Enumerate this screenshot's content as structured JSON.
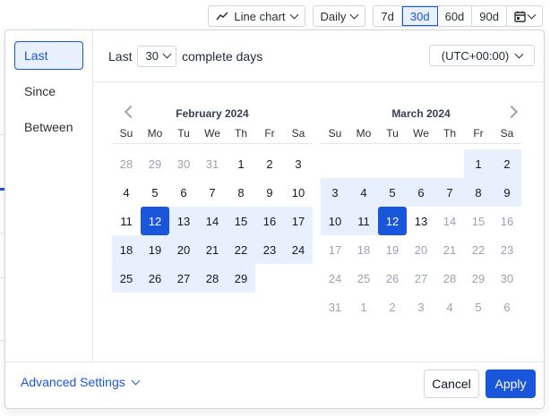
{
  "toolbar": {
    "chart_type": "Line chart",
    "interval": "Daily",
    "ranges": [
      "7d",
      "30d",
      "60d",
      "90d"
    ],
    "active_range": "30d"
  },
  "sidebar": {
    "items": [
      {
        "label": "Last",
        "active": true
      },
      {
        "label": "Since",
        "active": false
      },
      {
        "label": "Between",
        "active": false
      }
    ]
  },
  "header": {
    "prefix": "Last",
    "count": "30",
    "suffix": "complete days",
    "timezone": "(UTC+00:00)"
  },
  "weekdays": [
    "Su",
    "Mo",
    "Tu",
    "We",
    "Th",
    "Fr",
    "Sa"
  ],
  "calendars": [
    {
      "title": "February 2024",
      "id": "feb",
      "days": [
        {
          "d": "28",
          "s": "muted"
        },
        {
          "d": "29",
          "s": "muted"
        },
        {
          "d": "30",
          "s": "muted"
        },
        {
          "d": "31",
          "s": "muted"
        },
        {
          "d": "1",
          "s": ""
        },
        {
          "d": "2",
          "s": ""
        },
        {
          "d": "3",
          "s": ""
        },
        {
          "d": "4",
          "s": ""
        },
        {
          "d": "5",
          "s": ""
        },
        {
          "d": "6",
          "s": ""
        },
        {
          "d": "7",
          "s": ""
        },
        {
          "d": "8",
          "s": ""
        },
        {
          "d": "9",
          "s": ""
        },
        {
          "d": "10",
          "s": ""
        },
        {
          "d": "11",
          "s": ""
        },
        {
          "d": "12",
          "s": "selected"
        },
        {
          "d": "13",
          "s": "inrange"
        },
        {
          "d": "14",
          "s": "inrange"
        },
        {
          "d": "15",
          "s": "inrange"
        },
        {
          "d": "16",
          "s": "inrange"
        },
        {
          "d": "17",
          "s": "inrange"
        },
        {
          "d": "18",
          "s": "inrange"
        },
        {
          "d": "19",
          "s": "inrange"
        },
        {
          "d": "20",
          "s": "inrange"
        },
        {
          "d": "21",
          "s": "inrange"
        },
        {
          "d": "22",
          "s": "inrange"
        },
        {
          "d": "23",
          "s": "inrange"
        },
        {
          "d": "24",
          "s": "inrange"
        },
        {
          "d": "25",
          "s": "inrange"
        },
        {
          "d": "26",
          "s": "inrange"
        },
        {
          "d": "27",
          "s": "inrange"
        },
        {
          "d": "28",
          "s": "inrange"
        },
        {
          "d": "29",
          "s": "inrange"
        },
        {
          "d": "",
          "s": "empty"
        },
        {
          "d": "",
          "s": "empty"
        }
      ]
    },
    {
      "title": "March 2024",
      "id": "mar",
      "days": [
        {
          "d": "",
          "s": "empty"
        },
        {
          "d": "",
          "s": "empty"
        },
        {
          "d": "",
          "s": "empty"
        },
        {
          "d": "",
          "s": "empty"
        },
        {
          "d": "",
          "s": "empty"
        },
        {
          "d": "1",
          "s": "inrange"
        },
        {
          "d": "2",
          "s": "inrange"
        },
        {
          "d": "3",
          "s": "inrange"
        },
        {
          "d": "4",
          "s": "inrange"
        },
        {
          "d": "5",
          "s": "inrange"
        },
        {
          "d": "6",
          "s": "inrange"
        },
        {
          "d": "7",
          "s": "inrange"
        },
        {
          "d": "8",
          "s": "inrange"
        },
        {
          "d": "9",
          "s": "inrange"
        },
        {
          "d": "10",
          "s": "inrange"
        },
        {
          "d": "11",
          "s": "inrange"
        },
        {
          "d": "12",
          "s": "selected"
        },
        {
          "d": "13",
          "s": ""
        },
        {
          "d": "14",
          "s": "muted"
        },
        {
          "d": "15",
          "s": "muted"
        },
        {
          "d": "16",
          "s": "muted"
        },
        {
          "d": "17",
          "s": "muted"
        },
        {
          "d": "18",
          "s": "muted"
        },
        {
          "d": "19",
          "s": "muted"
        },
        {
          "d": "20",
          "s": "muted"
        },
        {
          "d": "21",
          "s": "muted"
        },
        {
          "d": "22",
          "s": "muted"
        },
        {
          "d": "23",
          "s": "muted"
        },
        {
          "d": "24",
          "s": "muted"
        },
        {
          "d": "25",
          "s": "muted"
        },
        {
          "d": "26",
          "s": "muted"
        },
        {
          "d": "27",
          "s": "muted"
        },
        {
          "d": "28",
          "s": "muted"
        },
        {
          "d": "29",
          "s": "muted"
        },
        {
          "d": "30",
          "s": "muted"
        },
        {
          "d": "31",
          "s": "muted"
        },
        {
          "d": "1",
          "s": "muted"
        },
        {
          "d": "2",
          "s": "muted"
        },
        {
          "d": "3",
          "s": "muted"
        },
        {
          "d": "4",
          "s": "muted"
        },
        {
          "d": "5",
          "s": "muted"
        },
        {
          "d": "6",
          "s": "muted"
        }
      ]
    }
  ],
  "footer": {
    "advanced": "Advanced Settings",
    "cancel": "Cancel",
    "apply": "Apply"
  },
  "colors": {
    "accent": "#1a56db",
    "range_bg": "#e8f0fe",
    "border": "#cfd6df",
    "muted_text": "#9ca3af"
  }
}
